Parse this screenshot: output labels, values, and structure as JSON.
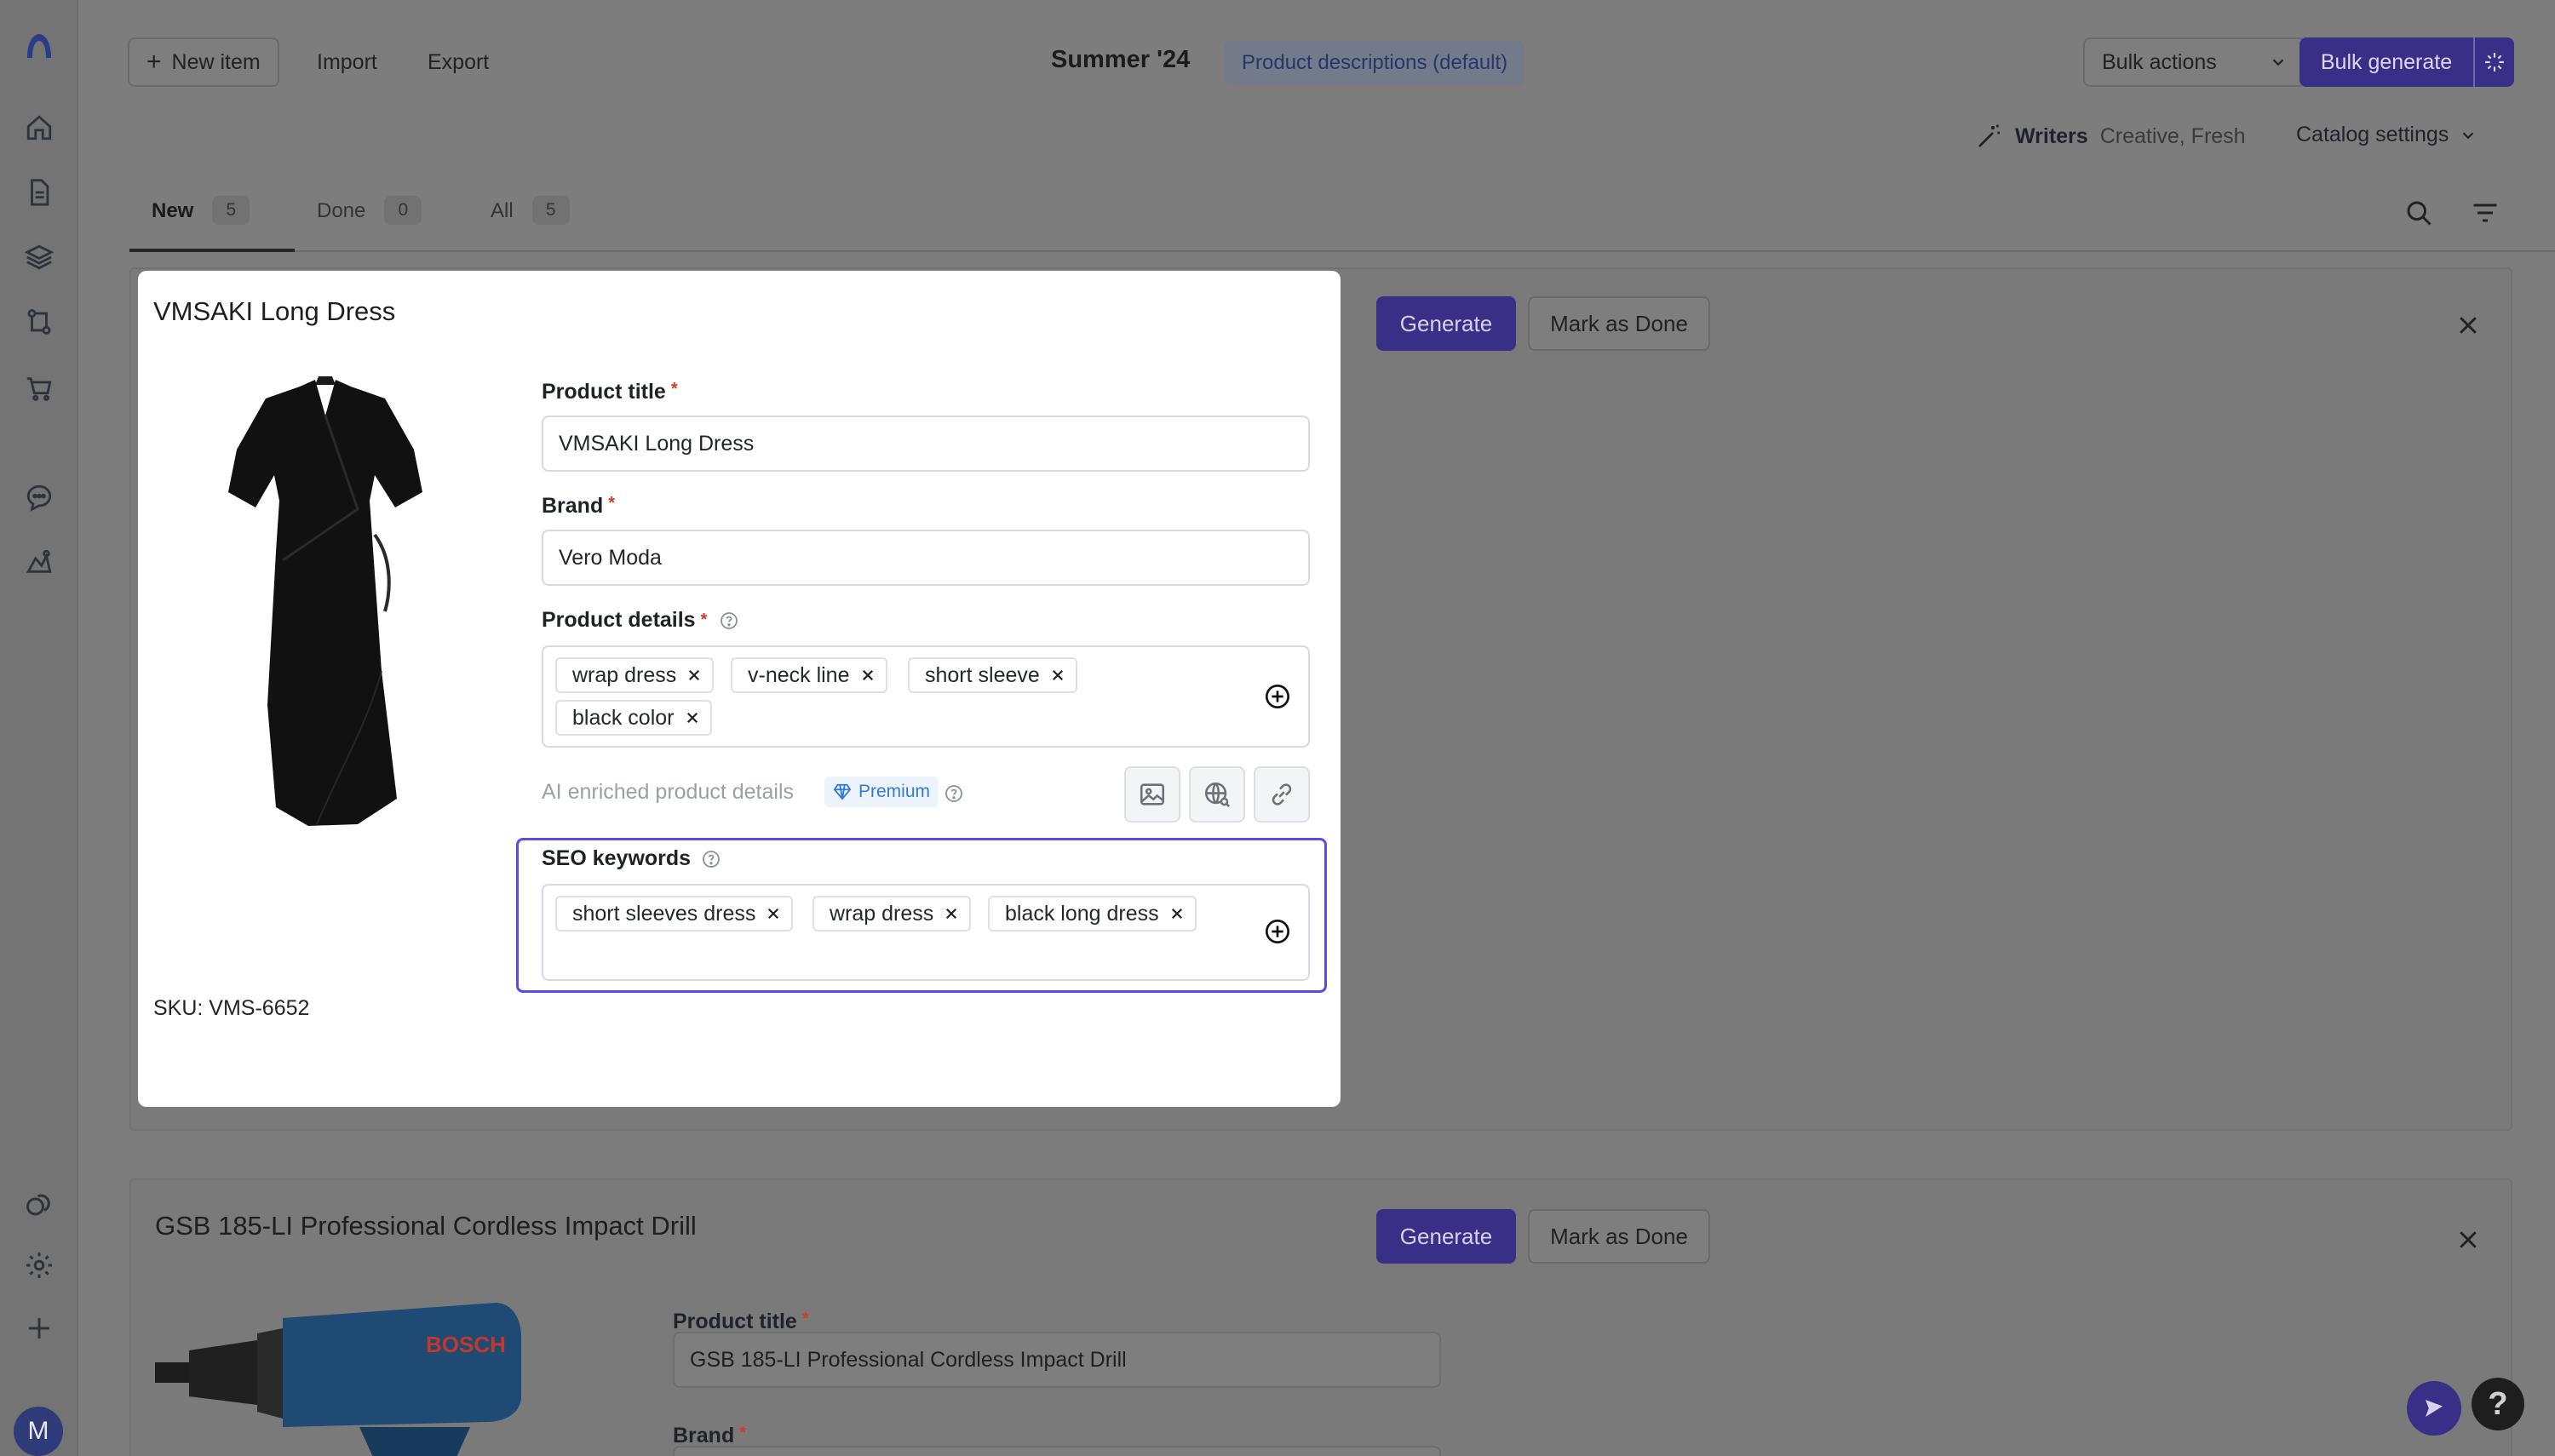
{
  "header": {
    "new_item": "New item",
    "import": "Import",
    "export": "Export",
    "catalog_name": "Summer '24",
    "template_badge": "Product descriptions (default)",
    "bulk_actions": "Bulk actions",
    "bulk_generate": "Bulk generate",
    "writers_label": "Writers",
    "writers_value": "Creative, Fresh",
    "catalog_settings": "Catalog settings"
  },
  "tabs": [
    {
      "label": "New",
      "count": "5",
      "active": true
    },
    {
      "label": "Done",
      "count": "0"
    },
    {
      "label": "All",
      "count": "5"
    }
  ],
  "items": [
    {
      "title": "VMSAKI Long Dress",
      "generate": "Generate",
      "mark_done": "Mark as Done",
      "sku": "SKU: VMS-6652",
      "product_title_label": "Product title",
      "product_title_value": "VMSAKI Long Dress",
      "brand_label": "Brand",
      "brand_value": "Vero Moda",
      "details_label": "Product details",
      "details": [
        "wrap dress",
        "v-neck line",
        "short sleeve",
        "black color"
      ],
      "ai_label": "AI enriched product details",
      "premium": "Premium",
      "seo_label": "SEO keywords",
      "seo": [
        "short sleeves dress",
        "wrap dress",
        "black long dress"
      ],
      "image_icon": "dress-photo"
    },
    {
      "title": "GSB 185-LI Professional Cordless Impact Drill",
      "generate": "Generate",
      "mark_done": "Mark as Done",
      "product_title_label": "Product title",
      "product_title_value": "GSB 185-LI Professional Cordless Impact Drill",
      "brand_label": "Brand",
      "image_icon": "drill-photo"
    }
  ],
  "sidebar": {
    "icons": [
      "logo-icon",
      "home-icon",
      "document-icon",
      "layers-icon",
      "workflow-icon",
      "cart-icon",
      "chat-icon",
      "analytics-icon",
      "integrations-icon",
      "settings-icon",
      "add-icon"
    ],
    "avatar": "M"
  },
  "colors": {
    "accent": "#5b4be0",
    "primary_button": "#3a2f86",
    "premium": "#2f7bd8",
    "required": "#d33a2c"
  }
}
